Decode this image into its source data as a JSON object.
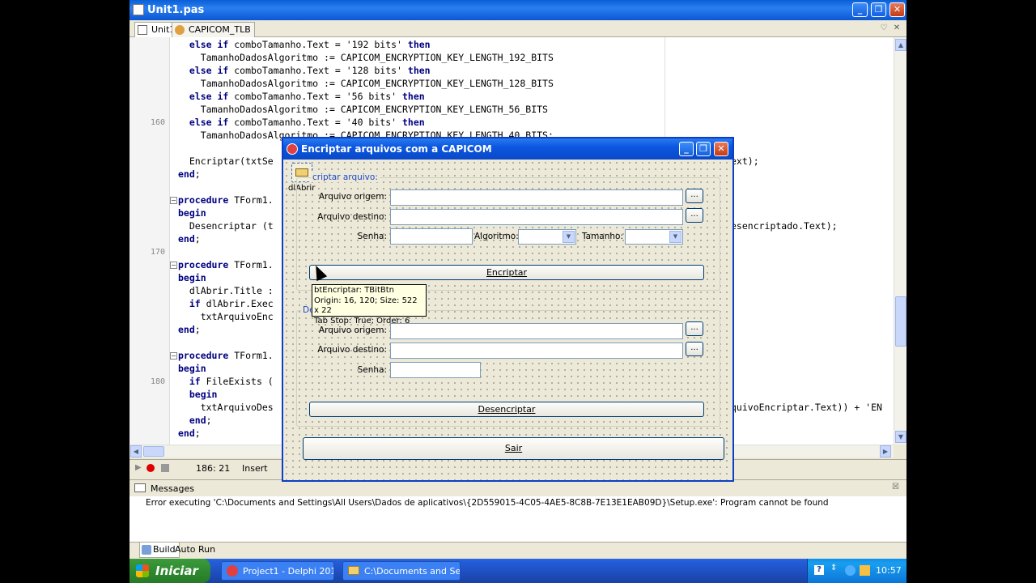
{
  "window": {
    "title": "Unit1.pas"
  },
  "tabs": [
    {
      "label": "Unit1"
    },
    {
      "label": "CAPICOM_TLB"
    }
  ],
  "code": {
    "lines": [
      {
        "indent": "  ",
        "parts": [
          {
            "k": 1,
            "t": "else if"
          },
          {
            "t": " comboTamanho.Text = '192 bits' "
          },
          {
            "k": 1,
            "t": "then"
          }
        ]
      },
      {
        "indent": "    ",
        "parts": [
          {
            "t": "TamanhoDadosAlgoritmo := CAPICOM_ENCRYPTION_KEY_LENGTH_192_BITS"
          }
        ]
      },
      {
        "indent": "  ",
        "parts": [
          {
            "k": 1,
            "t": "else if"
          },
          {
            "t": " comboTamanho.Text = '128 bits' "
          },
          {
            "k": 1,
            "t": "then"
          }
        ]
      },
      {
        "indent": "    ",
        "parts": [
          {
            "t": "TamanhoDadosAlgoritmo := CAPICOM_ENCRYPTION_KEY_LENGTH_128_BITS"
          }
        ]
      },
      {
        "indent": "  ",
        "parts": [
          {
            "k": 1,
            "t": "else if"
          },
          {
            "t": " comboTamanho.Text = '56 bits' "
          },
          {
            "k": 1,
            "t": "then"
          }
        ]
      },
      {
        "indent": "    ",
        "parts": [
          {
            "t": "TamanhoDadosAlgoritmo := CAPICOM_ENCRYPTION_KEY_LENGTH_56_BITS"
          }
        ]
      },
      {
        "indent": "  ",
        "parts": [
          {
            "k": 1,
            "t": "else if"
          },
          {
            "t": " comboTamanho.Text = '40 bits' "
          },
          {
            "k": 1,
            "t": "then"
          }
        ]
      },
      {
        "indent": "    ",
        "parts": [
          {
            "t": "TamanhoDadosAlgoritmo := CAPICOM_ENCRYPTION_KEY_LENGTH_40_BITS;"
          }
        ]
      },
      {
        "indent": "",
        "parts": [
          {
            "t": ""
          }
        ]
      },
      {
        "indent": "  ",
        "parts": [
          {
            "t": "Encriptar(txtSe"
          }
        ]
      },
      {
        "indent": "",
        "parts": [
          {
            "k": 1,
            "t": "end"
          },
          {
            "t": ";"
          }
        ]
      },
      {
        "indent": "",
        "parts": [
          {
            "t": ""
          }
        ]
      },
      {
        "indent": "",
        "parts": [
          {
            "k": 1,
            "t": "procedure"
          },
          {
            "t": " TForm1."
          }
        ]
      },
      {
        "indent": "",
        "parts": [
          {
            "k": 1,
            "t": "begin"
          }
        ]
      },
      {
        "indent": "  ",
        "parts": [
          {
            "t": "Desencriptar (t"
          }
        ]
      },
      {
        "indent": "",
        "parts": [
          {
            "k": 1,
            "t": "end"
          },
          {
            "t": ";"
          }
        ]
      },
      {
        "indent": "",
        "parts": [
          {
            "t": ""
          }
        ]
      },
      {
        "indent": "",
        "parts": [
          {
            "k": 1,
            "t": "procedure"
          },
          {
            "t": " TForm1."
          }
        ]
      },
      {
        "indent": "",
        "parts": [
          {
            "k": 1,
            "t": "begin"
          }
        ]
      },
      {
        "indent": "  ",
        "parts": [
          {
            "t": "dlAbrir.Title :"
          }
        ]
      },
      {
        "indent": "  ",
        "parts": [
          {
            "k": 1,
            "t": "if"
          },
          {
            "t": " dlAbrir.Exec"
          }
        ]
      },
      {
        "indent": "    ",
        "parts": [
          {
            "t": "txtArquivoEnc"
          }
        ]
      },
      {
        "indent": "",
        "parts": [
          {
            "k": 1,
            "t": "end"
          },
          {
            "t": ";"
          }
        ]
      },
      {
        "indent": "",
        "parts": [
          {
            "t": ""
          }
        ]
      },
      {
        "indent": "",
        "parts": [
          {
            "k": 1,
            "t": "procedure"
          },
          {
            "t": " TForm1."
          }
        ]
      },
      {
        "indent": "",
        "parts": [
          {
            "k": 1,
            "t": "begin"
          }
        ]
      },
      {
        "indent": "  ",
        "parts": [
          {
            "k": 1,
            "t": "if"
          },
          {
            "t": " FileExists ("
          }
        ]
      },
      {
        "indent": "  ",
        "parts": [
          {
            "k": 1,
            "t": "begin"
          }
        ]
      },
      {
        "indent": "    ",
        "parts": [
          {
            "t": "txtArquivoDes"
          }
        ]
      },
      {
        "indent": "  ",
        "parts": [
          {
            "k": 1,
            "t": "end"
          },
          {
            "t": ";"
          }
        ]
      },
      {
        "indent": "",
        "parts": [
          {
            "k": 1,
            "t": "end"
          },
          {
            "t": ";"
          }
        ]
      }
    ],
    "right_fragments": [
      {
        "line": 9,
        "text": "ext);"
      },
      {
        "line": 14,
        "text": "esencriptado.Text);"
      },
      {
        "line": 28,
        "text": "quivoEncriptar.Text)) + 'EN"
      }
    ],
    "line_numbers": [
      {
        "line": 6,
        "text": "160"
      },
      {
        "line": 16,
        "text": "170"
      },
      {
        "line": 26,
        "text": "180"
      }
    ]
  },
  "statusbar": {
    "position": "186: 21",
    "mode": "Insert"
  },
  "messages": {
    "title": "Messages",
    "text": "Error executing 'C:\\Documents and Settings\\All Users\\Dados de aplicativos\\{2D559015-4C05-4AE5-8C8B-7E13E1EAB09D}\\Setup.exe': Program cannot be found",
    "tabs": [
      "Build",
      "Auto Run"
    ]
  },
  "form": {
    "title": "Encriptar arquivos com a CAPICOM",
    "component_label": "dlAbrir",
    "encrypt_group": "Encriptar arquivo:",
    "encrypt_group_visible": "criptar arquivo:",
    "decrypt_group_visible": "De",
    "labels": {
      "origem": "Arquivo origem:",
      "destino": "Arquivo destino:",
      "senha": "Senha:",
      "algoritmo": "Algoritmo:",
      "tamanho": "Tamanho:"
    },
    "browse": "...",
    "encrypt_button": "Encriptar",
    "decrypt_button": "Desencriptar",
    "exit_button": "Sair"
  },
  "tooltip": {
    "line1": "btEncriptar: TBitBtn",
    "line2": "Origin: 16, 120; Size: 522 x 22",
    "line3": "Tab Stop: True; Order: 6"
  },
  "taskbar": {
    "start": "Iniciar",
    "items": [
      "Project1 - Delphi 201...",
      "C:\\Documents and Se..."
    ],
    "clock": "10:57"
  }
}
